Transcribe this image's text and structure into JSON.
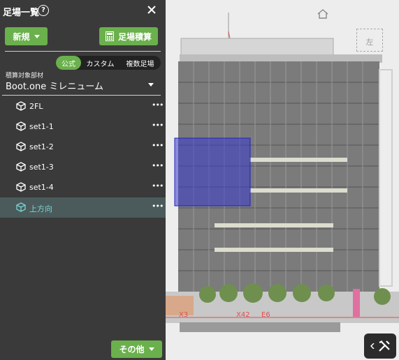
{
  "panel": {
    "title": "足場一覧",
    "help_glyph": "?",
    "new_button": "新規",
    "estimate_button": "足場積算",
    "tabs": [
      {
        "label": "公式",
        "active": true
      },
      {
        "label": "カスタム",
        "active": false
      },
      {
        "label": "複数足場",
        "active": false
      }
    ],
    "target_label": "積算対象部材",
    "target_value": "Boot.one ミレニューム",
    "items": [
      {
        "label": "2FL"
      },
      {
        "label": "set1-1"
      },
      {
        "label": "set1-2"
      },
      {
        "label": "set1-3"
      },
      {
        "label": "set1-4"
      },
      {
        "label": "上方向",
        "selected": true
      }
    ],
    "more_glyph": "•••",
    "other_button": "その他"
  },
  "viewer": {
    "view_cube_label": "左",
    "grid_labels": [
      "X3",
      "X42",
      "E6"
    ]
  },
  "colors": {
    "accent_green": "#6ab04c",
    "panel_bg": "#3a3a3a",
    "selected_bg": "#4b5b5b",
    "selection_blue": "#2b2bb8"
  }
}
